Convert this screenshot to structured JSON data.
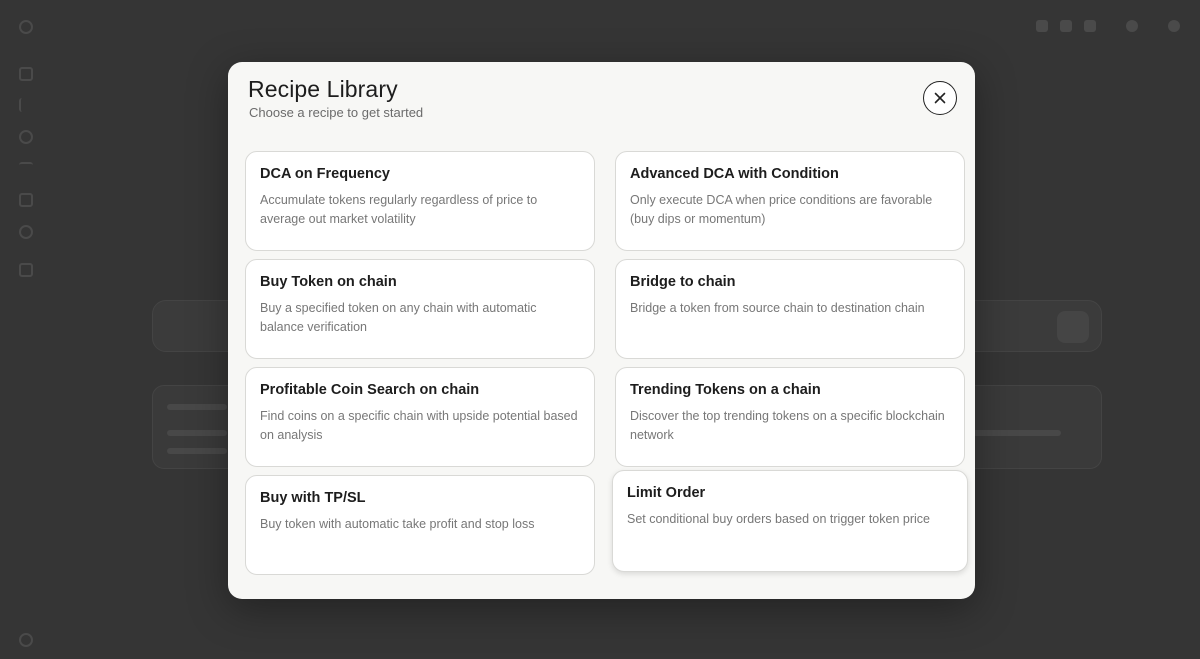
{
  "modal": {
    "title": "Recipe Library",
    "subtitle": "Choose a recipe to get started",
    "close_icon": "close-icon"
  },
  "recipes": [
    {
      "title": "DCA on Frequency",
      "description": "Accumulate tokens regularly regardless of price to average out market volatility"
    },
    {
      "title": "Advanced DCA with Condition",
      "description": "Only execute DCA when price conditions are favorable (buy dips or momentum)"
    },
    {
      "title": "Buy Token on chain",
      "description": "Buy a specified token on any chain with automatic balance verification"
    },
    {
      "title": "Bridge to chain",
      "description": "Bridge a token from source chain to destination chain"
    },
    {
      "title": "Profitable Coin Search on chain",
      "description": "Find coins on a specific chain with upside potential based on analysis"
    },
    {
      "title": "Trending Tokens on a chain",
      "description": "Discover the top trending tokens on a specific blockchain network"
    },
    {
      "title": "Buy with TP/SL",
      "description": "Buy token with automatic take profit and stop loss"
    },
    {
      "title": "Limit Order",
      "description": "Set conditional buy orders based on trigger token price"
    }
  ],
  "colors": {
    "overlay": "#353535",
    "modal_bg": "#f7f7f5",
    "card_bg": "#ffffff",
    "card_border": "#d9d9d6"
  }
}
